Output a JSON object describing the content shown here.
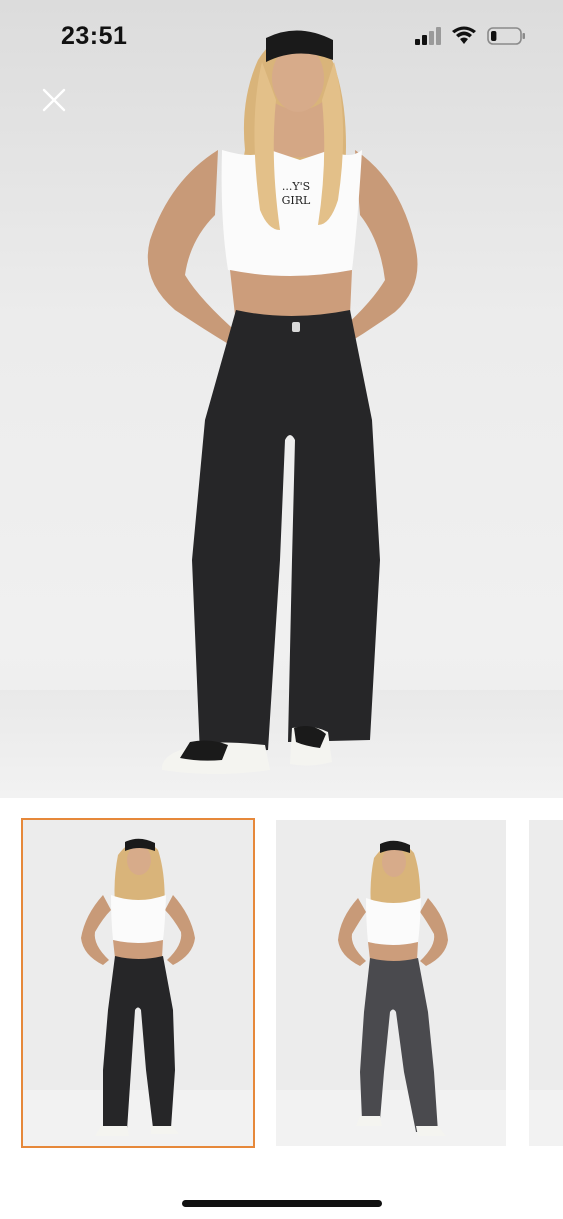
{
  "status_bar": {
    "time": "23:51",
    "icons": [
      "cellular-signal-icon",
      "wifi-icon",
      "battery-icon"
    ],
    "battery_level": 0.2
  },
  "gallery": {
    "close_icon": "close-icon",
    "hero_image": "product-photo-model-black-wide-leg-jeans-front",
    "shirt_print": "...Y'S GIRL",
    "thumbnails": [
      {
        "image": "model-black-jeans-front",
        "jeans_color": "#262628",
        "selected": true
      },
      {
        "image": "model-gray-jeans-front",
        "jeans_color": "#4a4a4e",
        "selected": false
      },
      {
        "image": "partial-thumbnail",
        "selected": false
      }
    ],
    "accent_color": "#e6883a"
  }
}
